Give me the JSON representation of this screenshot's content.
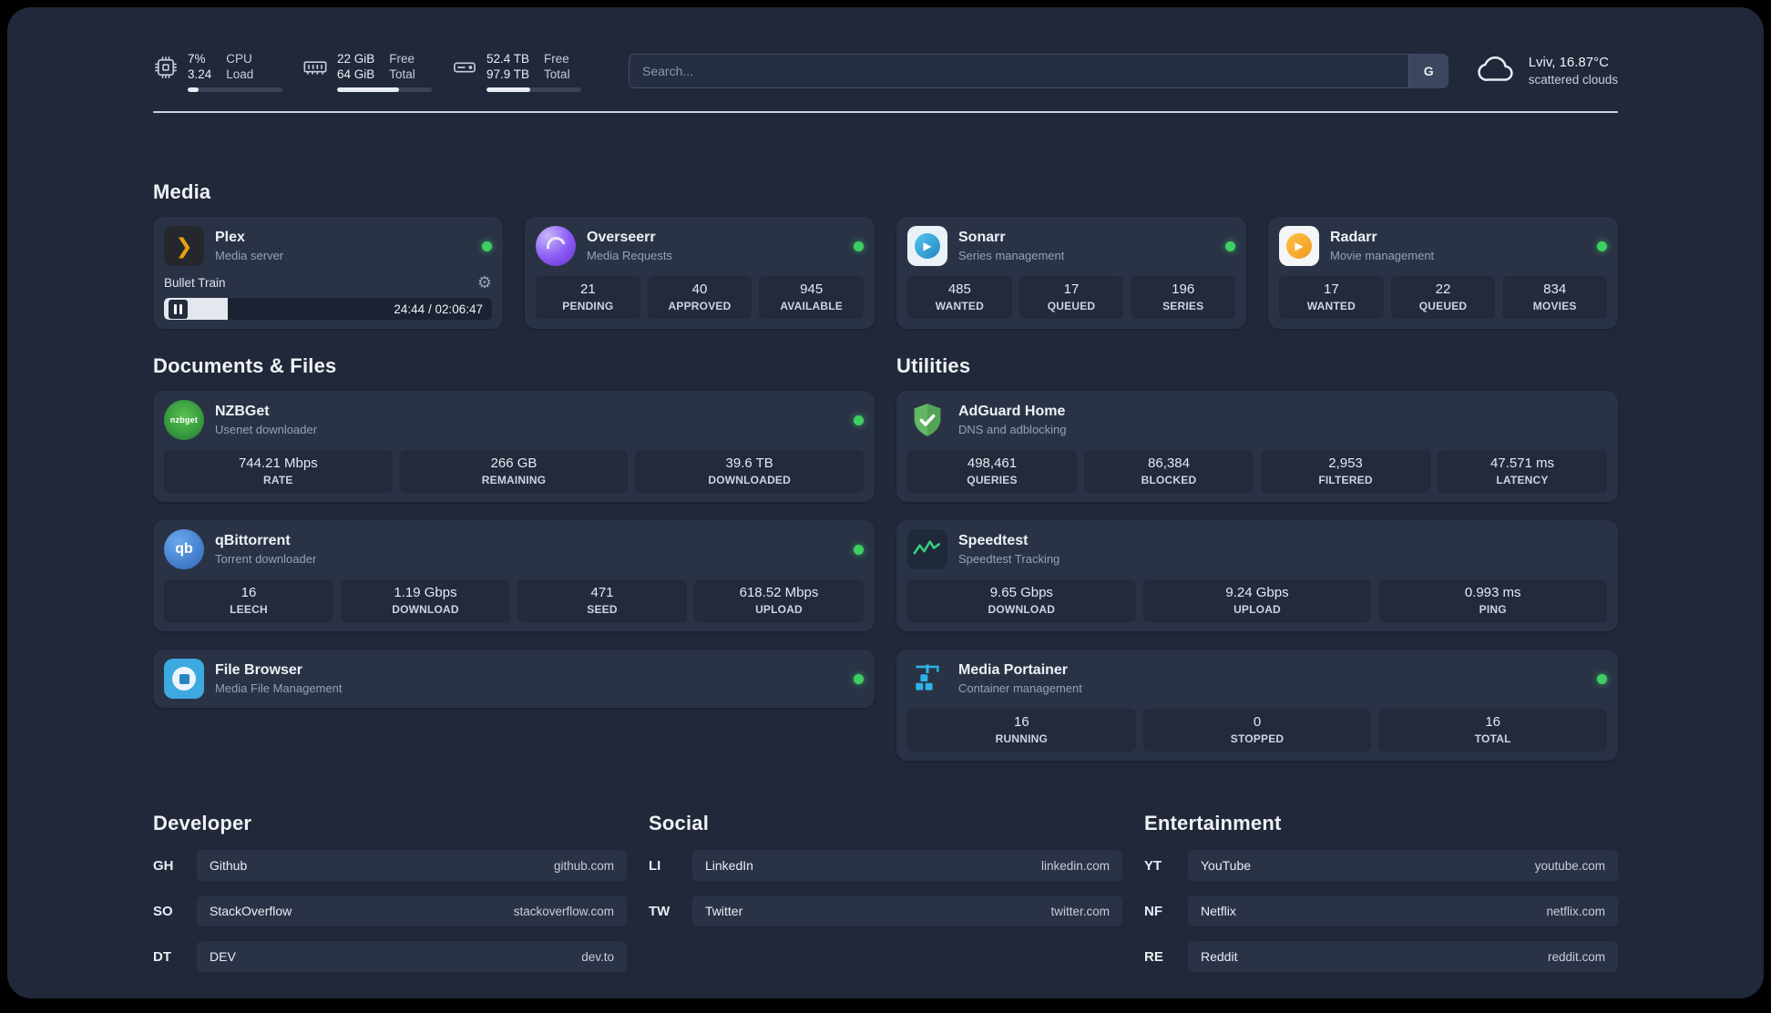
{
  "topbar": {
    "cpu": {
      "value": "7%",
      "sub": "3.24",
      "label_top": "CPU",
      "label_bottom": "Load",
      "percent": 12
    },
    "ram": {
      "value": "22 GiB",
      "sub": "64 GiB",
      "label_top": "Free",
      "label_bottom": "Total",
      "percent": 65
    },
    "disk": {
      "value": "52.4 TB",
      "sub": "97.9 TB",
      "label_top": "Free",
      "label_bottom": "Total",
      "percent": 46
    },
    "search": {
      "placeholder": "Search...",
      "button_label": "G"
    },
    "weather": {
      "location": "Lviv, 16.87°C",
      "condition": "scattered clouds"
    }
  },
  "media": {
    "title": "Media",
    "plex": {
      "name": "Plex",
      "subtitle": "Media server",
      "now_playing": "Bullet Train",
      "time": "24:44 / 02:06:47",
      "progress_percent": 19.5
    },
    "overseerr": {
      "name": "Overseerr",
      "subtitle": "Media Requests",
      "stats": [
        {
          "value": "21",
          "label": "PENDING"
        },
        {
          "value": "40",
          "label": "APPROVED"
        },
        {
          "value": "945",
          "label": "AVAILABLE"
        }
      ]
    },
    "sonarr": {
      "name": "Sonarr",
      "subtitle": "Series management",
      "stats": [
        {
          "value": "485",
          "label": "WANTED"
        },
        {
          "value": "17",
          "label": "QUEUED"
        },
        {
          "value": "196",
          "label": "SERIES"
        }
      ]
    },
    "radarr": {
      "name": "Radarr",
      "subtitle": "Movie management",
      "stats": [
        {
          "value": "17",
          "label": "WANTED"
        },
        {
          "value": "22",
          "label": "QUEUED"
        },
        {
          "value": "834",
          "label": "MOVIES"
        }
      ]
    }
  },
  "documents": {
    "title": "Documents & Files",
    "nzbget": {
      "name": "NZBGet",
      "subtitle": "Usenet downloader",
      "stats": [
        {
          "value": "744.21 Mbps",
          "label": "RATE"
        },
        {
          "value": "266 GB",
          "label": "REMAINING"
        },
        {
          "value": "39.6 TB",
          "label": "DOWNLOADED"
        }
      ]
    },
    "qbittorrent": {
      "name": "qBittorrent",
      "subtitle": "Torrent downloader",
      "stats": [
        {
          "value": "16",
          "label": "LEECH"
        },
        {
          "value": "1.19 Gbps",
          "label": "DOWNLOAD"
        },
        {
          "value": "471",
          "label": "SEED"
        },
        {
          "value": "618.52 Mbps",
          "label": "UPLOAD"
        }
      ]
    },
    "filebrowser": {
      "name": "File Browser",
      "subtitle": "Media File Management"
    }
  },
  "utilities": {
    "title": "Utilities",
    "adguard": {
      "name": "AdGuard Home",
      "subtitle": "DNS and adblocking",
      "stats": [
        {
          "value": "498,461",
          "label": "QUERIES"
        },
        {
          "value": "86,384",
          "label": "BLOCKED"
        },
        {
          "value": "2,953",
          "label": "FILTERED"
        },
        {
          "value": "47.571 ms",
          "label": "LATENCY"
        }
      ]
    },
    "speedtest": {
      "name": "Speedtest",
      "subtitle": "Speedtest Tracking",
      "stats": [
        {
          "value": "9.65 Gbps",
          "label": "DOWNLOAD"
        },
        {
          "value": "9.24 Gbps",
          "label": "UPLOAD"
        },
        {
          "value": "0.993 ms",
          "label": "PING"
        }
      ]
    },
    "portainer": {
      "name": "Media Portainer",
      "subtitle": "Container management",
      "stats": [
        {
          "value": "16",
          "label": "RUNNING"
        },
        {
          "value": "0",
          "label": "STOPPED"
        },
        {
          "value": "16",
          "label": "TOTAL"
        }
      ]
    }
  },
  "links": {
    "developer": {
      "title": "Developer",
      "items": [
        {
          "prefix": "GH",
          "label": "Github",
          "url": "github.com"
        },
        {
          "prefix": "SO",
          "label": "StackOverflow",
          "url": "stackoverflow.com"
        },
        {
          "prefix": "DT",
          "label": "DEV",
          "url": "dev.to"
        }
      ]
    },
    "social": {
      "title": "Social",
      "items": [
        {
          "prefix": "LI",
          "label": "LinkedIn",
          "url": "linkedin.com"
        },
        {
          "prefix": "TW",
          "label": "Twitter",
          "url": "twitter.com"
        }
      ]
    },
    "entertainment": {
      "title": "Entertainment",
      "items": [
        {
          "prefix": "YT",
          "label": "YouTube",
          "url": "youtube.com"
        },
        {
          "prefix": "NF",
          "label": "Netflix",
          "url": "netflix.com"
        },
        {
          "prefix": "RE",
          "label": "Reddit",
          "url": "reddit.com"
        }
      ]
    }
  },
  "colors": {
    "status_green": "#3ecf63",
    "nzbget_logo_text": "nzbget",
    "qbit_logo_text": "qb"
  }
}
